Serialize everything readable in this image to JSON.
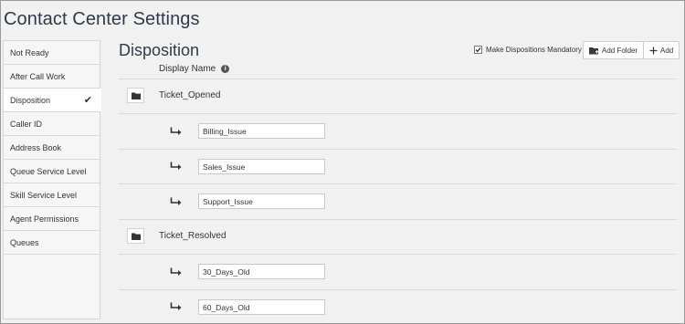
{
  "app": {
    "title": "Contact Center Settings"
  },
  "sidebar": {
    "items": [
      {
        "label": "Not Ready"
      },
      {
        "label": "After Call Work"
      },
      {
        "label": "Disposition",
        "active": true,
        "check": "✔"
      },
      {
        "label": "Caller ID"
      },
      {
        "label": "Address Book"
      },
      {
        "label": "Queue Service Level"
      },
      {
        "label": "Skill Service Level"
      },
      {
        "label": "Agent Permissions"
      },
      {
        "label": "Queues"
      }
    ]
  },
  "main": {
    "title": "Disposition",
    "mandatory_label": "Make Dispositions Mandatory",
    "mandatory_checked": true,
    "add_folder_label": "Add Folder",
    "add_label": "Add",
    "column_header": "Display Name",
    "folders": [
      {
        "name": "Ticket_Opened",
        "items": [
          "Billing_Issue",
          "Sales_Issue",
          "Support_Issue"
        ]
      },
      {
        "name": "Ticket_Resolved",
        "items": [
          "30_Days_Old",
          "60_Days_Old"
        ]
      }
    ]
  },
  "colors": {
    "title": "#2f3b48",
    "border": "#d9d9d9",
    "background": "#f1f1f1"
  }
}
